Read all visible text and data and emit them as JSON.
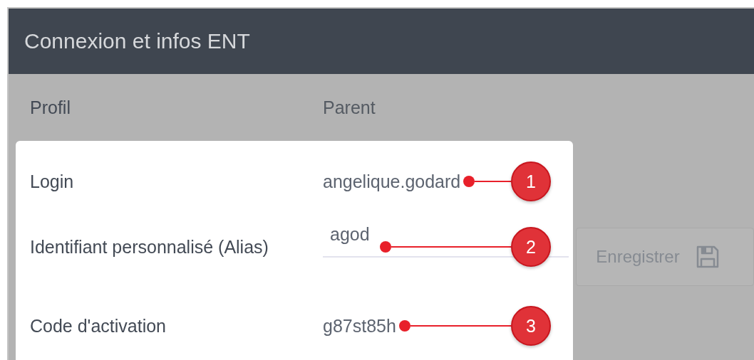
{
  "panel": {
    "title": "Connexion et infos ENT"
  },
  "profile": {
    "label": "Profil",
    "value": "Parent"
  },
  "fields": [
    {
      "kind": "text",
      "label": "Login",
      "value": "angelique.godard",
      "callout": "1"
    },
    {
      "kind": "input",
      "label": "Identifiant personnalisé (Alias)",
      "value": "agod",
      "callout": "2"
    },
    {
      "kind": "text",
      "label": "Code d'activation",
      "value": "g87st85h",
      "callout": "3"
    }
  ],
  "save_button": {
    "label": "Enregistrer",
    "disabled": true
  }
}
